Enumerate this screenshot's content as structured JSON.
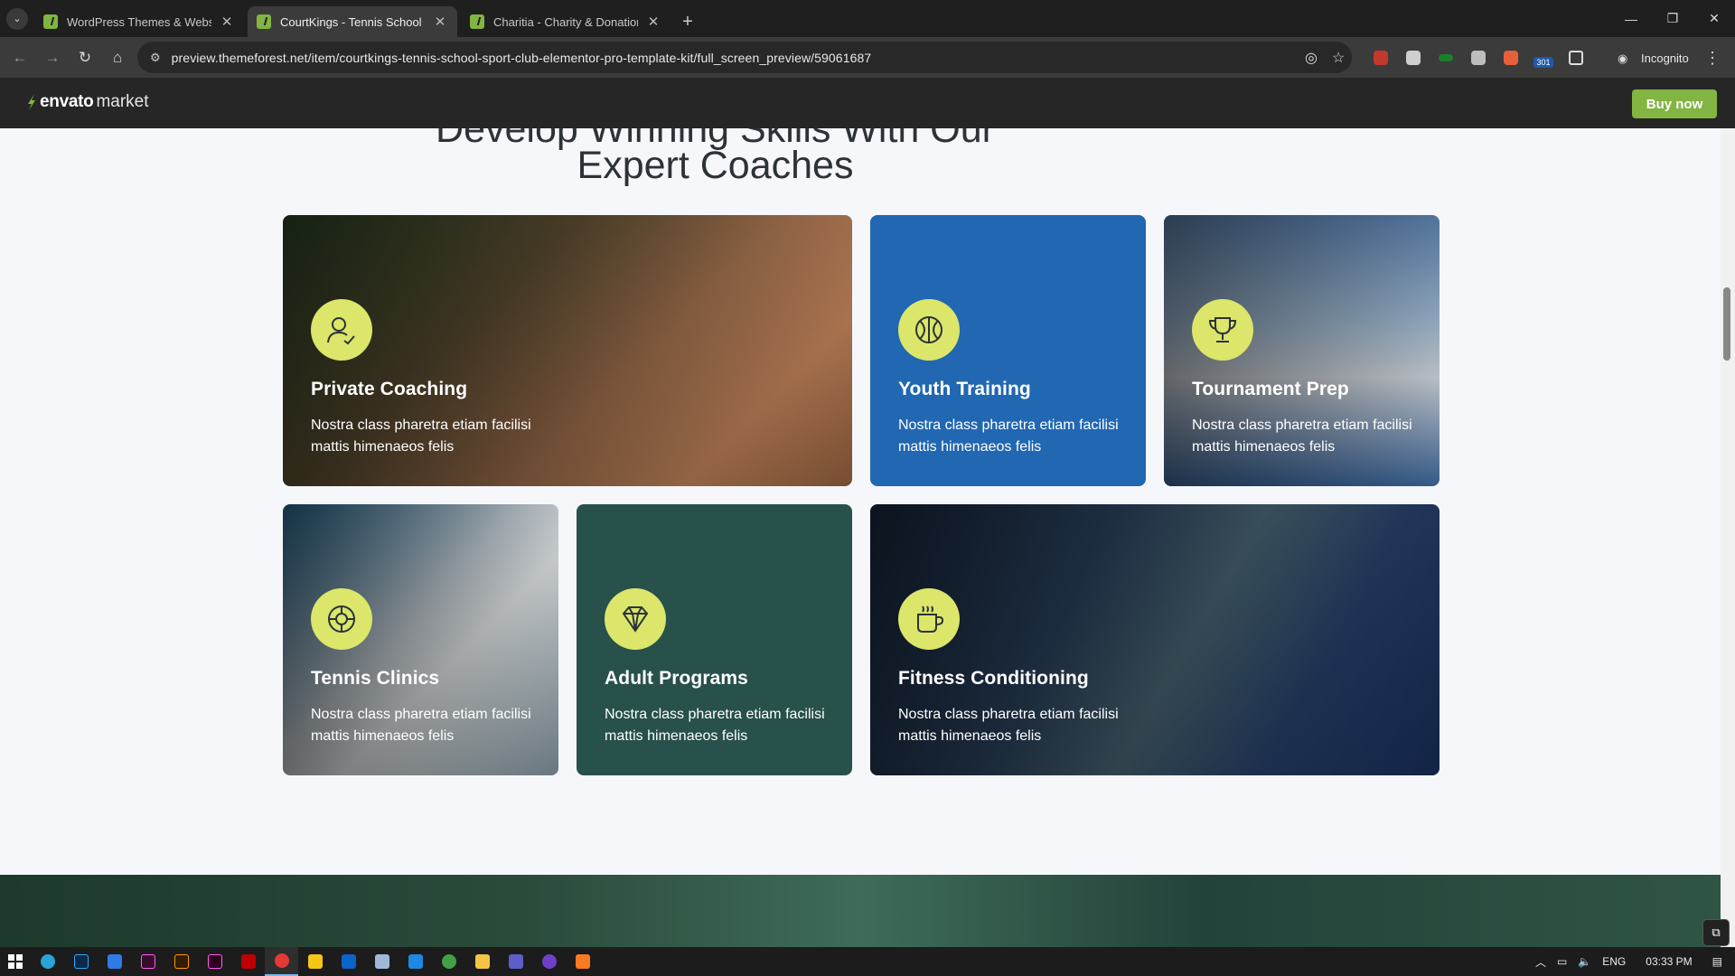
{
  "browser": {
    "tabs": [
      {
        "label": "WordPress Themes & Website Templates",
        "active": false
      },
      {
        "label": "CourtKings - Tennis School & Sport",
        "active": true
      },
      {
        "label": "Charitia - Charity & Donation Sport",
        "active": false
      }
    ],
    "url": "preview.themeforest.net/item/courtkings-tennis-school-sport-club-elementor-pro-template-kit/full_screen_preview/59061687",
    "incognito_label": "Incognito",
    "ext_badge": "301"
  },
  "envato": {
    "logo_bold": "envato",
    "logo_light": "market",
    "buy_label": "Buy now"
  },
  "section": {
    "heading_line1": "Develop Winning Skills With Our",
    "heading_line2": "Expert Coaches"
  },
  "cards": [
    {
      "title": "Private Coaching",
      "desc": "Nostra class pharetra etiam facilisi mattis himenaeos felis",
      "icon": "person-check-icon",
      "bg": "photo"
    },
    {
      "title": "Youth Training",
      "desc": "Nostra class pharetra etiam facilisi mattis himenaeos felis",
      "icon": "ball-icon",
      "bg": "#2167b2"
    },
    {
      "title": "Tournament Prep",
      "desc": "Nostra class pharetra etiam facilisi mattis himenaeos felis",
      "icon": "trophy-icon",
      "bg": "photo"
    },
    {
      "title": "Tennis Clinics",
      "desc": "Nostra class pharetra etiam facilisi mattis himenaeos felis",
      "icon": "lifebuoy-icon",
      "bg": "photo"
    },
    {
      "title": "Adult Programs",
      "desc": "Nostra class pharetra etiam facilisi mattis himenaeos felis",
      "icon": "diamond-icon",
      "bg": "#27514a"
    },
    {
      "title": "Fitness Conditioning",
      "desc": "Nostra class pharetra etiam facilisi mattis himenaeos felis",
      "icon": "cup-icon",
      "bg": "photo"
    }
  ],
  "colors": {
    "accent": "#dbe66a",
    "buy": "#82b541",
    "blue_card": "#2167b2",
    "green_card": "#27514a"
  },
  "taskbar": {
    "lang": "ENG",
    "time": "03:33 PM"
  }
}
